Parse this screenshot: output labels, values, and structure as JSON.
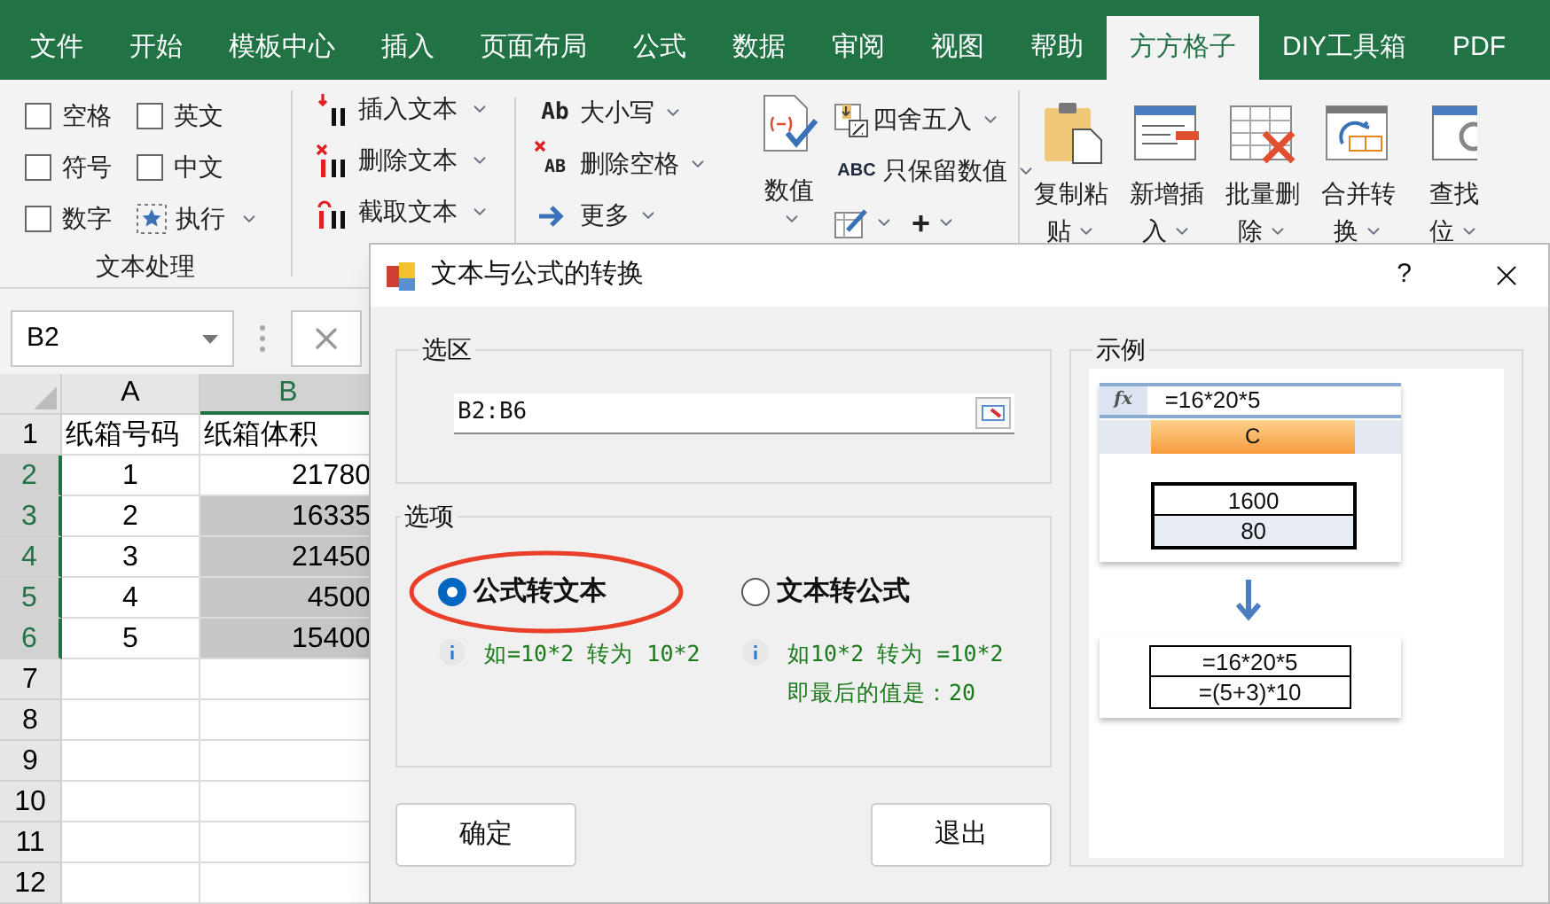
{
  "tabs": [
    {
      "label": "文件",
      "selected": false
    },
    {
      "label": "开始",
      "selected": false
    },
    {
      "label": "模板中心",
      "selected": false
    },
    {
      "label": "插入",
      "selected": false
    },
    {
      "label": "页面布局",
      "selected": false
    },
    {
      "label": "公式",
      "selected": false
    },
    {
      "label": "数据",
      "selected": false
    },
    {
      "label": "审阅",
      "selected": false
    },
    {
      "label": "视图",
      "selected": false
    },
    {
      "label": "帮助",
      "selected": false
    },
    {
      "label": "方方格子",
      "selected": true
    },
    {
      "label": "DIY工具箱",
      "selected": false
    },
    {
      "label": "PDF",
      "selected": false
    }
  ],
  "text_group": {
    "checkboxes": [
      {
        "label": "空格",
        "checked": false
      },
      {
        "label": "符号",
        "checked": false
      },
      {
        "label": "数字",
        "checked": false
      },
      {
        "label": "英文",
        "checked": false
      },
      {
        "label": "中文",
        "checked": false
      }
    ],
    "run_button": "执行",
    "label": "文本处理"
  },
  "text_tools": [
    {
      "kind": "insert",
      "label": "插入文本"
    },
    {
      "kind": "delete",
      "label": "删除文本"
    },
    {
      "kind": "extract",
      "label": "截取文本"
    }
  ],
  "case_tools": [
    {
      "kind": "case",
      "icon_text": "Ab",
      "label": "大小写"
    },
    {
      "kind": "space",
      "icon_text": "AB",
      "label": "删除空格"
    },
    {
      "kind": "more",
      "label": "更多"
    }
  ],
  "number_group": {
    "value_button": "数值",
    "items": [
      {
        "kind": "round",
        "label": "四舍五入"
      },
      {
        "kind": "keep",
        "icon_text": "ABC",
        "label": "只保留数值"
      }
    ],
    "plus": "+"
  },
  "big_buttons": [
    {
      "kind": "paste",
      "line1": "复制粘",
      "line2": "贴"
    },
    {
      "kind": "insert",
      "line1": "新增插",
      "line2": "入"
    },
    {
      "kind": "delete",
      "line1": "批量删",
      "line2": "除"
    },
    {
      "kind": "merge",
      "line1": "合并转",
      "line2": "换"
    },
    {
      "kind": "find",
      "line1": "查找",
      "line2": "位"
    }
  ],
  "sheet": {
    "name_box": "B2",
    "columns": [
      {
        "label": "A",
        "selected": false
      },
      {
        "label": "B",
        "selected": true
      }
    ],
    "rows": [
      {
        "num": "1",
        "selected": false,
        "cells": [
          {
            "text": "纸箱号码",
            "selected": false
          },
          {
            "text": "纸箱体积",
            "selected": false
          }
        ]
      },
      {
        "num": "2",
        "selected": true,
        "cells": [
          {
            "text": "1",
            "selected": false
          },
          {
            "text": "21780",
            "selected": false
          }
        ]
      },
      {
        "num": "3",
        "selected": true,
        "cells": [
          {
            "text": "2",
            "selected": false
          },
          {
            "text": "16335",
            "selected": true
          }
        ]
      },
      {
        "num": "4",
        "selected": true,
        "cells": [
          {
            "text": "3",
            "selected": false
          },
          {
            "text": "21450",
            "selected": true
          }
        ]
      },
      {
        "num": "5",
        "selected": true,
        "cells": [
          {
            "text": "4",
            "selected": false
          },
          {
            "text": "4500",
            "selected": true
          }
        ]
      },
      {
        "num": "6",
        "selected": true,
        "cells": [
          {
            "text": "5",
            "selected": false
          },
          {
            "text": "15400",
            "selected": true
          }
        ]
      },
      {
        "num": "7",
        "selected": false,
        "cells": []
      },
      {
        "num": "8",
        "selected": false,
        "cells": []
      },
      {
        "num": "9",
        "selected": false,
        "cells": []
      },
      {
        "num": "10",
        "selected": false,
        "cells": []
      },
      {
        "num": "11",
        "selected": false,
        "cells": []
      },
      {
        "num": "12",
        "selected": false,
        "cells": []
      }
    ]
  },
  "dialog": {
    "title": "文本与公式的转换",
    "help": "?",
    "range_group": {
      "legend": "选区",
      "value": "B2:B6"
    },
    "options_group": {
      "legend": "选项",
      "options": [
        {
          "label": "公式转文本",
          "selected": true,
          "circled": true,
          "hint": [
            "如=10*2 转为 10*2"
          ]
        },
        {
          "label": "文本转公式",
          "selected": false,
          "circled": false,
          "hint": [
            "如10*2 转为 =10*2",
            "即最后的值是：20"
          ]
        }
      ]
    },
    "buttons": [
      "确定",
      "退出"
    ],
    "example": {
      "legend": "示例",
      "fx": "fx",
      "formula": "=16*20*5",
      "column": "C",
      "before": [
        "1600",
        "80"
      ],
      "after": [
        "=16*20*5",
        "=(5+3)*10"
      ]
    }
  }
}
